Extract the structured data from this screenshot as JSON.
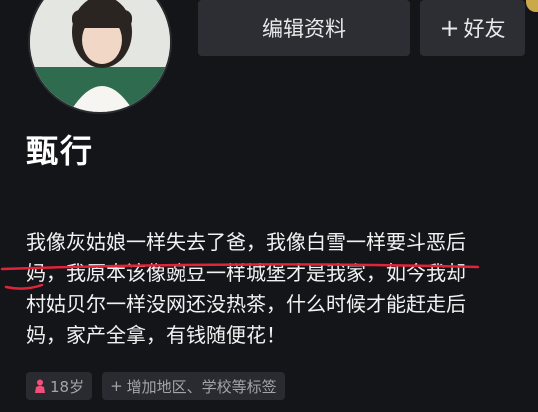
{
  "profile": {
    "name": "甄行",
    "bio_lines": [
      "我像灰姑娘一样失去了爸，我像白雪一样要斗恶后",
      "妈，我原本该像豌豆一样城堡才是我家，如今我却",
      "村姑贝尔一样没网还没热茶，什么时候才能赶走后",
      "妈，家产全拿，有钱随便花！"
    ]
  },
  "buttons": {
    "edit_profile": "编辑资料",
    "add_friend_plus": "+",
    "add_friend": "好友"
  },
  "tags": {
    "age": "18岁",
    "add_info_plus": "+",
    "add_info": "增加地区、学校等标签"
  },
  "colors": {
    "background": "#141519",
    "button_bg": "#2d2e34",
    "underline": "#e0243a",
    "gender_icon": "#f0507a"
  },
  "icons": {
    "avatar": "profile-photo",
    "gender": "female-person-icon"
  }
}
